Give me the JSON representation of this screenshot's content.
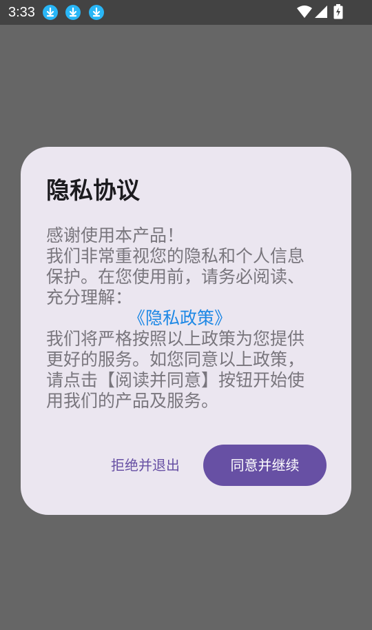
{
  "status_bar": {
    "time": "3:33",
    "notification_icons": [
      "download-icon",
      "download-icon",
      "download-icon"
    ],
    "right_icons": [
      "wifi-icon",
      "signal-icon",
      "battery-charging-icon"
    ]
  },
  "dialog": {
    "title": "隐私协议",
    "body_lines": [
      "感谢使用本产品！",
      "我们非常重视您的隐私和个人信息保护。在您使用前，请务必阅读、充分理解："
    ],
    "policy_link": "《隐私政策》",
    "body_after": "我们将严格按照以上政策为您提供更好的服务。如您同意以上政策，请点击【阅读并同意】按钮开始使用我们的产品及服务。",
    "reject_label": "拒绝并退出",
    "accept_label": "同意并继续"
  },
  "colors": {
    "accent": "#6750a4",
    "link": "#1e88e5",
    "scrim": "#666666",
    "dialog_bg": "#ebe6f0"
  }
}
